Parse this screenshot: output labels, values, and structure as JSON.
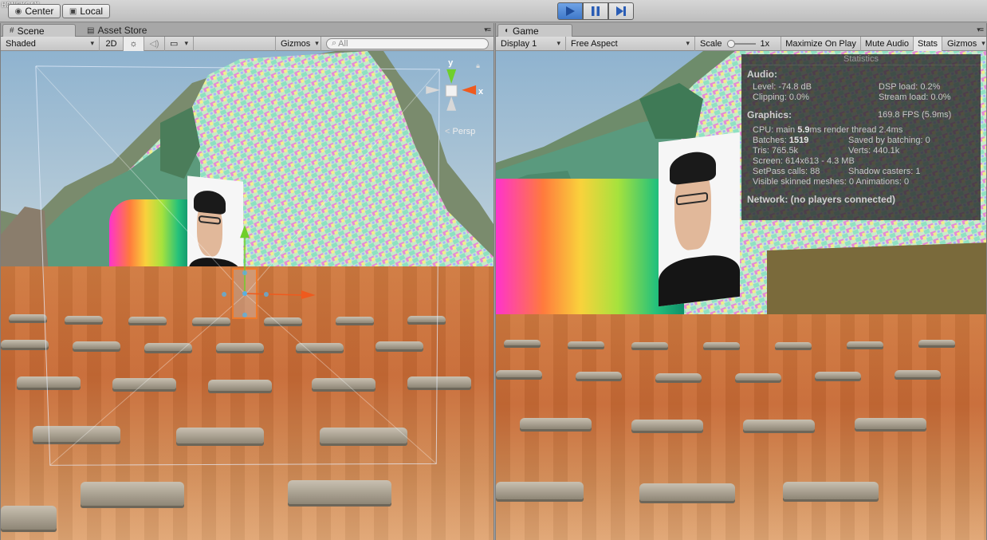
{
  "watermark": "HONEYCAM",
  "topbar": {
    "pivot_label": "Center",
    "space_label": "Local"
  },
  "scene": {
    "tab_label": "Scene",
    "tab2_label": "Asset Store",
    "shading_mode": "Shaded",
    "mode_2d": "2D",
    "gizmos_label": "Gizmos",
    "search_placeholder": "All",
    "persp_label": "Persp",
    "axis_y": "y",
    "axis_x": "x"
  },
  "game": {
    "tab_label": "Game",
    "display": "Display 1",
    "aspect": "Free Aspect",
    "scale_label": "Scale",
    "scale_value": "1x",
    "maximize_on_play": "Maximize On Play",
    "mute_audio": "Mute Audio",
    "stats": "Stats",
    "gizmos": "Gizmos"
  },
  "statistics": {
    "title": "Statistics",
    "audio_header": "Audio:",
    "level": "Level: -74.8 dB",
    "dsp_load": "DSP load: 0.2%",
    "clipping": "Clipping: 0.0%",
    "stream_load": "Stream load: 0.0%",
    "graphics_header": "Graphics:",
    "fps": "169.8 FPS (5.9ms)",
    "cpu_prefix": "CPU: main ",
    "cpu_main": "5.9",
    "cpu_suffix": "ms  render thread 2.4ms",
    "batches_prefix": "Batches: ",
    "batches": "1519",
    "saved_batching": "Saved by batching: 0",
    "tris": "Tris: 765.5k",
    "verts": "Verts: 440.1k",
    "screen": "Screen: 614x613 - 4.3 MB",
    "setpass": "SetPass calls: 88",
    "shadow_casters": "Shadow casters: 1",
    "skinned": "Visible skinned meshes: 0  Animations: 0",
    "network": "Network: (no players connected)"
  },
  "colors": {
    "play_active": "#3f78c9",
    "selection_orange": "#f07a2a",
    "gizmo_green": "#6fcf2a",
    "gizmo_red": "#ef5a1e"
  },
  "icons": {
    "play": "play-icon",
    "pause": "pause-icon",
    "step": "step-icon",
    "lock": "lock-icon",
    "menu": "tab-menu-icon"
  }
}
